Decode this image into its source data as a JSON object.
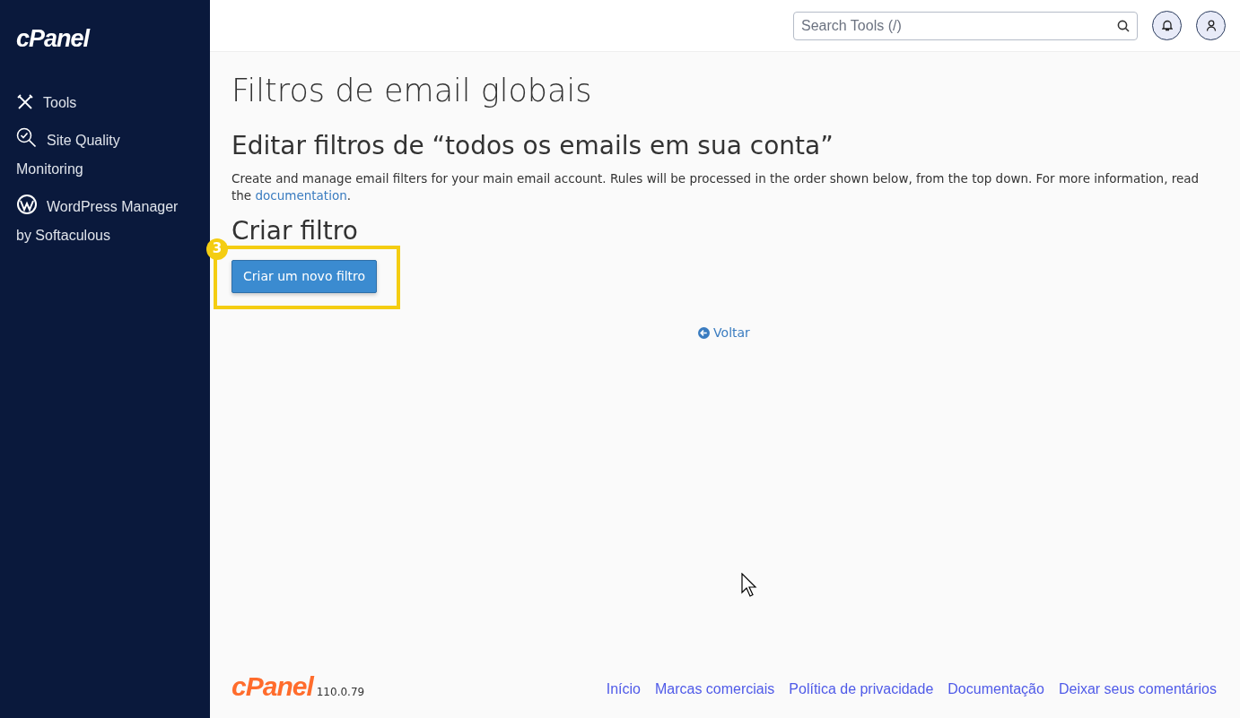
{
  "sidebar": {
    "logo": "cPanel",
    "items": [
      {
        "label": "Tools"
      },
      {
        "label": "Site Quality Monitoring"
      },
      {
        "label": "WordPress Manager by Softaculous"
      }
    ]
  },
  "topbar": {
    "search": {
      "placeholder": "Search Tools (/)"
    }
  },
  "page": {
    "title": "Filtros de email globais",
    "subtitle": "Editar filtros de “todos os emails em sua conta”",
    "description": "Create and manage email filters for your main email account. Rules will be processed in the order shown below, from the top down. For more information, read the ",
    "description_link": "documentation",
    "description_end": ".",
    "section_title": "Criar filtro",
    "create_button": "Criar um novo filtro",
    "callout_number": "3",
    "back_link": "Voltar"
  },
  "footer": {
    "logo": "cPanel",
    "version": "110.0.79",
    "links": [
      "Início",
      "Marcas comerciais",
      "Política de privacidade",
      "Documentação",
      "Deixar seus comentários"
    ]
  }
}
